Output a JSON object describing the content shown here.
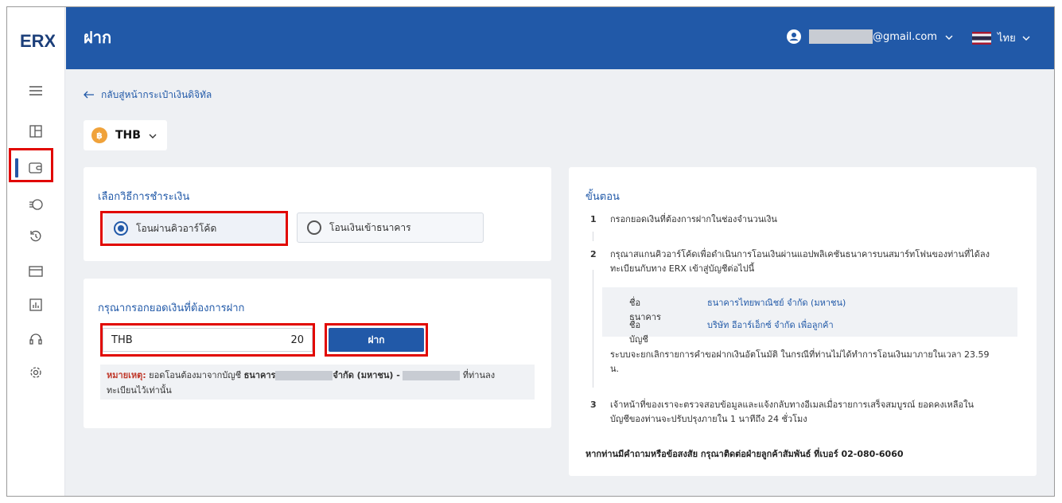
{
  "sidebar": {
    "logo": "ERX",
    "icons": [
      "menu-icon",
      "dashboard-icon",
      "wallet-icon",
      "withdraw-icon",
      "history-icon",
      "bank-card-icon",
      "report-icon",
      "support-icon",
      "settings-icon"
    ]
  },
  "header": {
    "title": "ฝาก",
    "email_suffix": "@gmail.com",
    "language": "ไทย"
  },
  "nav": {
    "back_label": "กลับสู่หน้ากระเป๋าเงินดิจิทัล"
  },
  "currency": {
    "code": "THB",
    "coin_symbol": "฿"
  },
  "payment_method": {
    "title": "เลือกวิธีการชำระเงิน",
    "option_qr": "โอนผ่านคิวอาร์โค้ด",
    "option_bank": "โอนเงินเข้าธนาคาร",
    "selected": "qr"
  },
  "amount": {
    "title": "กรุณากรอกยอดเงินที่ต้องการฝาก",
    "currency": "THB",
    "value": "20",
    "button": "ฝาก"
  },
  "note": {
    "label": "หมายเหตุ:",
    "text1": " ยอดโอนต้องมาจากบัญชี ",
    "bank": "ธนาคาร",
    "company": "จำกัด (มหาชน) -",
    "text2": " ที่ท่านลง",
    "text3": "ทะเบียนไว้เท่านั้น"
  },
  "steps": {
    "title": "ขั้นตอน",
    "step1_num": "1",
    "step1": "กรอกยอดเงินที่ต้องการฝากในช่องจำนวนเงิน",
    "step2_num": "2",
    "step2_line1": "กรุณาสแกนคิวอาร์โค้ดเพื่อดำเนินการโอนเงินผ่านแอปพลิเคชันธนาคารบนสมาร์ทโฟนของท่านที่ได้ลง",
    "step2_line2": "ทะเบียนกับทาง ERX เข้าสู่บัญชีต่อไปนี้",
    "bank_name_label": "ชื่อธนาคาร",
    "bank_name_value": "ธนาคารไทยพาณิชย์ จำกัด (มหาชน)",
    "account_name_label": "ชื่อบัญชี",
    "account_name_value": "บริษัท อีอาร์เอ็กซ์ จำกัด เพื่อลูกค้า",
    "cancel_line1": "ระบบจะยกเลิกรายการคำขอฝากเงินอัตโนมัติ ในกรณีที่ท่านไม่ได้ทำการโอนเงินมาภายในเวลา 23.59",
    "cancel_line2": "น.",
    "step3_num": "3",
    "step3_line1": "เจ้าหน้าที่ของเราจะตรวจสอบข้อมูลและแจ้งกลับทางอีเมลเมื่อรายการเสร็จสมบูรณ์ ยอดคงเหลือใน",
    "step3_line2": "บัญชีของท่านจะปรับปรุงภายใน 1 นาทีถึง 24 ชั่วโมง",
    "contact": "หากท่านมีคำถามหรือข้อสงสัย กรุณาติดต่อฝ่ายลูกค้าสัมพันธ์ ที่เบอร์ 02-080-6060"
  },
  "colors": {
    "primary": "#2159a8",
    "highlight": "#e10600",
    "background": "#eef0f3"
  }
}
